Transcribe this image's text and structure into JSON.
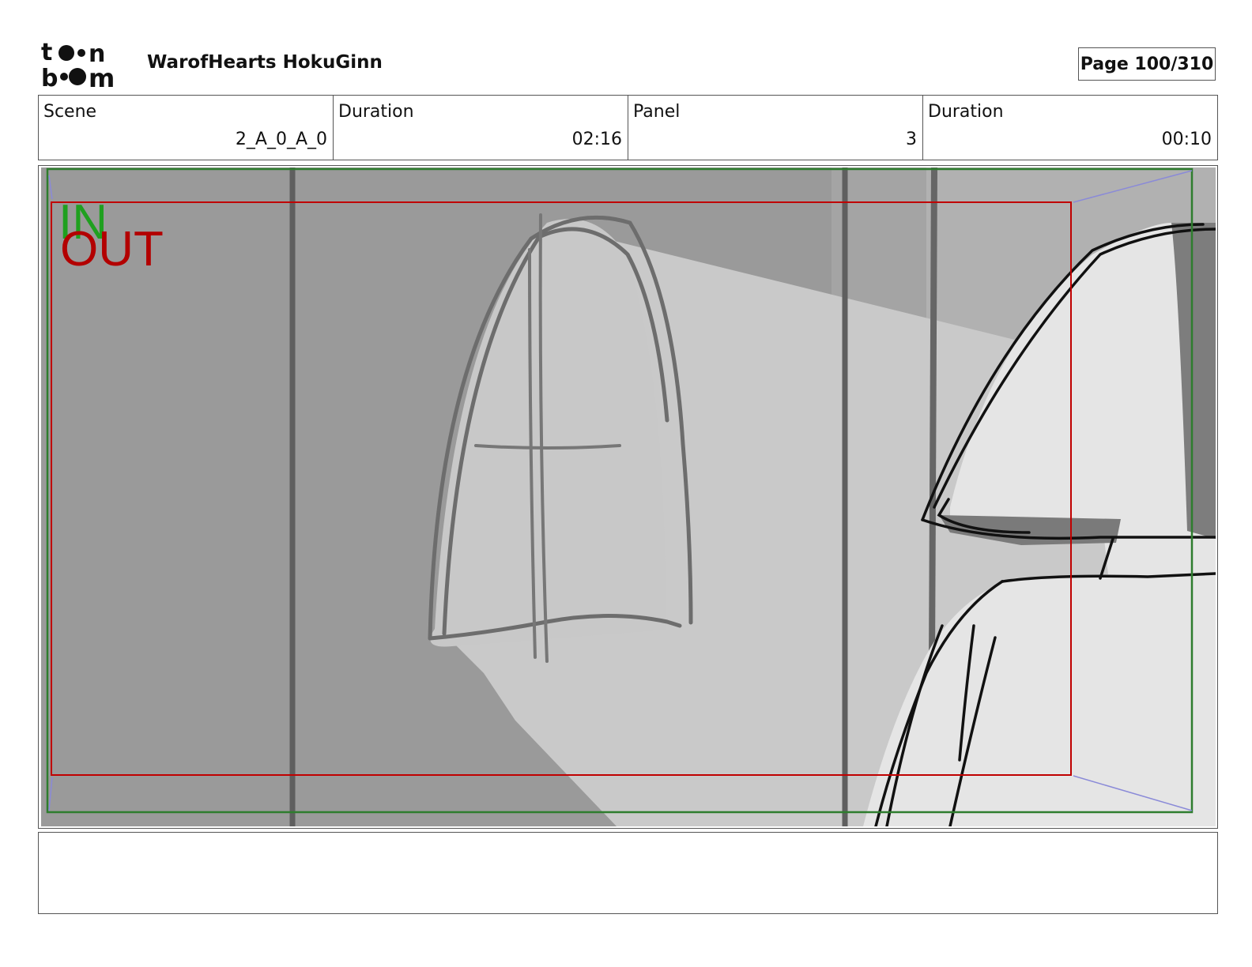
{
  "header": {
    "logo_text": "toon boom",
    "project_title": "WarofHearts HokuGinn",
    "page_indicator": "Page 100/310"
  },
  "info": {
    "scene_label": "Scene",
    "scene_value": "2_A_0_A_0",
    "scene_duration_label": "Duration",
    "scene_duration_value": "02:16",
    "panel_label": "Panel",
    "panel_value": "3",
    "panel_duration_label": "Duration",
    "panel_duration_value": "00:10"
  },
  "panel": {
    "in_label": "IN",
    "out_label": "OUT",
    "in_color": "#1fa01f",
    "out_color": "#b30000"
  },
  "notes": {
    "text": ""
  }
}
